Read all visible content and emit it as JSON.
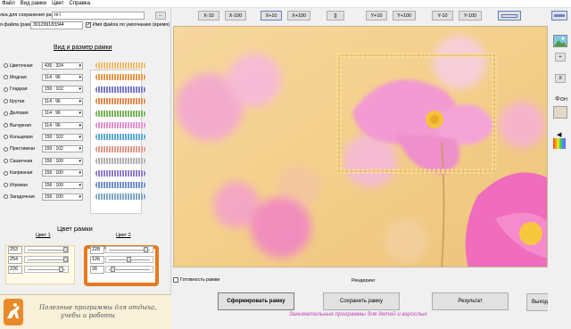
{
  "menu": [
    "Файл",
    "Вид рамки",
    "Цвет",
    "Справка"
  ],
  "path_field": {
    "label": "лка для сохранения рамок",
    "value": "m:\\",
    "browse_label": "..."
  },
  "file_field": {
    "label": "я файла (рамка)",
    "value": "301299183344",
    "default_checkbox_label": "Имя файла по умолчанию (время)"
  },
  "frames_section_title": "Вид и размер рамки",
  "frames": [
    {
      "name": "Цветочная",
      "size": "436 : 324",
      "color": "#f2b96a"
    },
    {
      "name": "Модная",
      "size": "114 : 96",
      "color": "#e9964e"
    },
    {
      "name": "Гладкая",
      "size": "150 : 102",
      "color": "#7b79c6"
    },
    {
      "name": "Крутая",
      "size": "114 : 96",
      "color": "#e58a4f"
    },
    {
      "name": "Деловая",
      "size": "114 : 96",
      "color": "#7bb05a"
    },
    {
      "name": "Вычурная",
      "size": "114 : 96",
      "color": "#e691d0"
    },
    {
      "name": "Кольцевая",
      "size": "150 : 102",
      "color": "#5fa8d6"
    },
    {
      "name": "Престижная",
      "size": "150 : 102",
      "color": "#e29a8a"
    },
    {
      "name": "Сказочная",
      "size": "156 : 100",
      "color": "#b0b0b0"
    },
    {
      "name": "Капризная",
      "size": "156 : 100",
      "color": "#8e7dc8"
    },
    {
      "name": "Игровая",
      "size": "156 : 100",
      "color": "#6f8fd0"
    },
    {
      "name": "Загадочная",
      "size": "156 : 100",
      "color": "#7fa6c9"
    }
  ],
  "color_section_title": "Цвет рамки",
  "color1": {
    "label": "Цвет 1",
    "r": "253",
    "g": "254",
    "b": "226",
    "r_level": 0.99,
    "g_level": 0.99,
    "b_level": 0.89
  },
  "color2": {
    "label": "Цвет 2",
    "r": "228",
    "g": "126",
    "b": "26",
    "r_level": 0.89,
    "g_level": 0.49,
    "b_level": 0.1
  },
  "promo": {
    "line1": "Полезные программы для отдыха,",
    "line2": "учебы и работы"
  },
  "toolbar": {
    "x_minus_10": "X-10",
    "x_minus_100": "X-100",
    "x_plus_10": "X+10",
    "x_plus_100": "X+100",
    "center": "[]",
    "y_plus_10": "Y+10",
    "y_plus_100": "Y+100",
    "y_minus_10": "Y-10",
    "y_minus_100": "Y-100"
  },
  "readiness_label": "Готовность рамки",
  "rendering_label": "Рендеринг",
  "buttons": {
    "form": "Сформировать рамку",
    "save": "Сохранить рамку",
    "result": "Результат",
    "exit": "Выход"
  },
  "footer_link": "Занимательные программы для детей и взрослых",
  "right_panel": {
    "bg_label": "Фон",
    "plus": "+",
    "x": "X"
  },
  "colors": {
    "accent_orange": "#e57a1e",
    "footer_link": "#c040c0",
    "canvas_bg": "#f3cf8a"
  }
}
